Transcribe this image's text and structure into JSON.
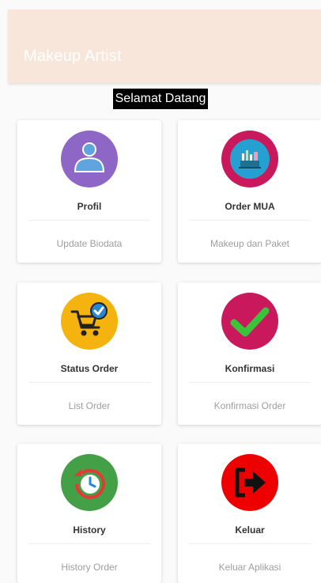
{
  "status_bar": {
    "left": "",
    "right": ""
  },
  "app_bar": {
    "title": "Makeup Artist"
  },
  "welcome": "Selamat Datang",
  "colors": {
    "app_bar": "#f9e6da",
    "profil": "#8e67c6",
    "order": "#c9195c",
    "status": "#f5b30f",
    "konfirmasi": "#c9195c",
    "history": "#43a047",
    "keluar": "#ee0000"
  },
  "menu": [
    {
      "title": "Profil",
      "subtitle": "Update Biodata",
      "icon": "user-icon"
    },
    {
      "title": "Order MUA",
      "subtitle": "Makeup dan Paket",
      "icon": "makeup-kit-icon"
    },
    {
      "title": "Status Order",
      "subtitle": "List Order",
      "icon": "cart-check-icon"
    },
    {
      "title": "Konfirmasi",
      "subtitle": "Konfirmasi Order",
      "icon": "checkmark-icon"
    },
    {
      "title": "History",
      "subtitle": "History Order",
      "icon": "clock-history-icon"
    },
    {
      "title": "Keluar",
      "subtitle": "Keluar Aplikasi",
      "icon": "exit-arrow-icon"
    }
  ]
}
